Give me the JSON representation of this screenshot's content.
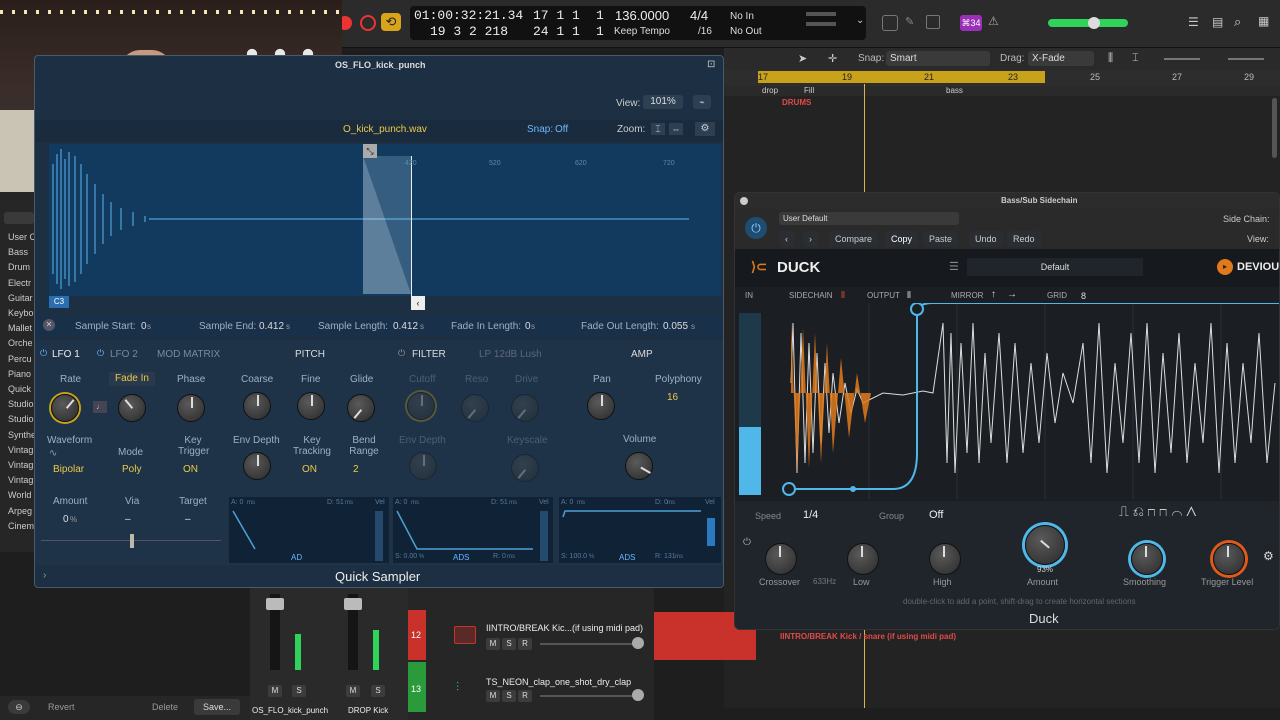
{
  "transport": {
    "time_top": "01:00:32:21.34",
    "time_bottom": "19 3 2 218",
    "bar_top": "17 1 1",
    "bar_top_end": "1",
    "bar_bottom": "24 1 1",
    "bar_bottom_end": "1",
    "tempo": "136.0000",
    "tempo_mode": "Keep Tempo",
    "sig_top": "4/4",
    "sig_bottom": "/16",
    "in_label": "No In",
    "out_label": "No Out",
    "badge": "⌘34"
  },
  "arrange": {
    "snap_label": "Snap:",
    "snap_value": "Smart",
    "drag_label": "Drag:",
    "drag_value": "X-Fade",
    "ruler": [
      "17",
      "19",
      "21",
      "23",
      "25",
      "27",
      "29"
    ],
    "markers": [
      "drop",
      "Fill",
      "bass"
    ],
    "region_drums": "DRUMS",
    "region_kick": "IINTRO/BREAK Kick / snare (if using midi pad)"
  },
  "sampler": {
    "title": "OS_FLO_kick_punch",
    "view_label": "View:",
    "view_value": "101%",
    "file_name": "O_kick_punch.wav",
    "snap_label": "Snap:",
    "snap_value": "Off",
    "zoom_label": "Zoom:",
    "ruler": [
      "420",
      "520",
      "620",
      "720"
    ],
    "note": "C3",
    "sample_start_label": "Sample Start:",
    "sample_start": "0",
    "sample_start_unit": "s",
    "sample_end_label": "Sample End:",
    "sample_end": "0.412",
    "sample_end_unit": "s",
    "sample_length_label": "Sample Length:",
    "sample_length": "0.412",
    "sample_length_unit": "s",
    "fade_in_label": "Fade In Length:",
    "fade_in": "0",
    "fade_in_unit": "s",
    "fade_out_label": "Fade Out Length:",
    "fade_out": "0.055",
    "fade_out_unit": "s",
    "tabs": [
      "LFO 1",
      "LFO 2",
      "MOD MATRIX"
    ],
    "sections": {
      "pitch": "PITCH",
      "filter": "FILTER",
      "amp": "AMP"
    },
    "filter_type": "LP 12dB Lush",
    "lfo": {
      "rate": "Rate",
      "fade_in": "Fade In",
      "phase": "Phase",
      "waveform": "Waveform",
      "waveform_value": "Bipolar",
      "mode": "Mode",
      "mode_value": "Poly",
      "key_trigger": "Key Trigger",
      "key_trigger_value": "ON",
      "amount": "Amount",
      "amount_value": "0",
      "amount_unit": "%",
      "via": "Via",
      "via_value": "–",
      "target": "Target",
      "target_value": "–"
    },
    "pitch": {
      "coarse": "Coarse",
      "fine": "Fine",
      "glide": "Glide",
      "env_depth": "Env Depth",
      "key_tracking": "Key Tracking",
      "key_tracking_value": "ON",
      "bend_range": "Bend Range",
      "bend_value": "2"
    },
    "filter": {
      "cutoff": "Cutoff",
      "reso": "Reso",
      "drive": "Drive",
      "env_depth": "Env Depth",
      "keyscale": "Keyscale"
    },
    "amp": {
      "pan": "Pan",
      "polyphony": "Polyphony",
      "polyphony_value": "16",
      "volume": "Volume"
    },
    "env1": {
      "a": "A: 0",
      "a_unit": "ms",
      "d": "D: 51",
      "d_unit": "ms",
      "mode": "AD",
      "vel": "Vel"
    },
    "env2": {
      "a": "A: 0",
      "a_unit": "ms",
      "d": "D: 51",
      "d_unit": "ms",
      "s": "S: 0.00",
      "s_unit": "%",
      "mode": "ADS",
      "r": "R: 0",
      "r_unit": "ms",
      "vel": "Vel"
    },
    "env3": {
      "a": "A: 0",
      "a_unit": "ms",
      "d": "D: 0",
      "d_unit": "ms",
      "s": "S: 100.0",
      "s_unit": "%",
      "mode": "ADS",
      "r": "R: 131",
      "r_unit": "ms",
      "vel": "Vel"
    },
    "footer": "Quick Sampler"
  },
  "duck": {
    "window_title": "Bass/Sub Sidechain",
    "preset": "User Default",
    "side_chain_label": "Side Chain:",
    "view_label": "View:",
    "compare": "Compare",
    "copy": "Copy",
    "paste": "Paste",
    "undo": "Undo",
    "redo": "Redo",
    "brand": "DUCK",
    "preset_name": "Default",
    "devious": "DEVIOUS",
    "in": "IN",
    "sidechain": "SIDECHAIN",
    "output": "OUTPUT",
    "mirror": "MIRROR",
    "grid": "GRID",
    "grid_value": "8",
    "speed_label": "Speed",
    "speed_value": "1/4",
    "group_label": "Group",
    "group_value": "Off",
    "crossover": "Crossover",
    "crossover_value": "633Hz",
    "low": "Low",
    "high": "High",
    "amount": "Amount",
    "amount_value": "93%",
    "smoothing": "Smoothing",
    "trigger_level": "Trigger Level",
    "hint": "double-click to add a point, shift-drag to create horizontal sections",
    "footer": "Duck",
    "accent": "#4fb8e8",
    "orange": "#e07a1a"
  },
  "library": {
    "items": [
      "User C",
      "Bass",
      "Drum",
      "Electr",
      "Guitar",
      "Keybo",
      "Mallet",
      "Orche",
      "Percu",
      "Piano",
      "Quick",
      "Studio",
      "Studio",
      "Synthe",
      "Vintag",
      "Vintag",
      "Vintag",
      "World",
      "Arpeg",
      "Cinem"
    ]
  },
  "mixer": {
    "strip1": "OS_FLO_kick_punch",
    "strip2": "DROP Kick",
    "m": "M",
    "s": "S",
    "r": "R",
    "revert": "Revert",
    "delete": "Delete",
    "save": "Save..."
  },
  "tracks": [
    {
      "num": "12",
      "name": "IINTRO/BREAK Kic...(if using midi pad)",
      "color": "#c8322a"
    },
    {
      "num": "13",
      "name": "TS_NEON_clap_one_shot_dry_clap",
      "color": "#2a9a3a"
    }
  ]
}
